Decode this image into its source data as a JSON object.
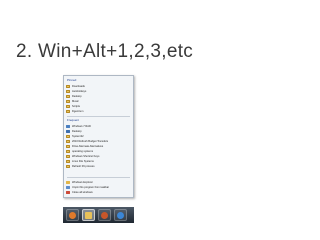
{
  "slide": {
    "title": "2. Win+Alt+1,2,3,etc"
  },
  "jumplist": {
    "pinned_label": "Pinned",
    "pinned_items": [
      {
        "label": "Downloads",
        "icon": "folder-icon"
      },
      {
        "label": "Autohotkeys",
        "icon": "folder-icon"
      },
      {
        "label": "Desktop",
        "icon": "folder-icon"
      },
      {
        "label": "Music",
        "icon": "folder-icon"
      },
      {
        "label": "Scripts",
        "icon": "folder-icon"
      },
      {
        "label": "Dgentrum",
        "icon": "folder-icon"
      }
    ],
    "frequent_label": "Frequent",
    "frequent_items": [
      {
        "label": "Windows 7 RAD",
        "icon": "computer-icon"
      },
      {
        "label": "Desktop",
        "icon": "desktop-icon"
      },
      {
        "label": "System32",
        "icon": "folder-icon"
      },
      {
        "label": "2010 Refresh Budget Transfers",
        "icon": "folder-icon"
      },
      {
        "label": "Drive Alternate Alternatives",
        "icon": "folder-icon"
      },
      {
        "label": "operating systems",
        "icon": "folder-icon"
      },
      {
        "label": "Windows Shortcut Keys",
        "icon": "folder-icon"
      },
      {
        "label": "Linux File Systems",
        "icon": "folder-icon"
      },
      {
        "label": "Refresh 09 process",
        "icon": "folder-icon"
      }
    ],
    "task_items": [
      {
        "label": "Windows Explorer",
        "icon": "explorer-icon"
      },
      {
        "label": "Unpin this program from taskbar",
        "icon": "unpin-icon"
      },
      {
        "label": "Close all windows",
        "icon": "close-icon"
      }
    ]
  },
  "taskbar": {
    "buttons": [
      {
        "name": "media-player-icon",
        "color": "#e07a2b"
      },
      {
        "name": "explorer-icon",
        "color": "#e8c15a"
      },
      {
        "name": "firefox-icon",
        "color": "#c6562a"
      },
      {
        "name": "ie-icon",
        "color": "#3b86d6"
      }
    ]
  }
}
